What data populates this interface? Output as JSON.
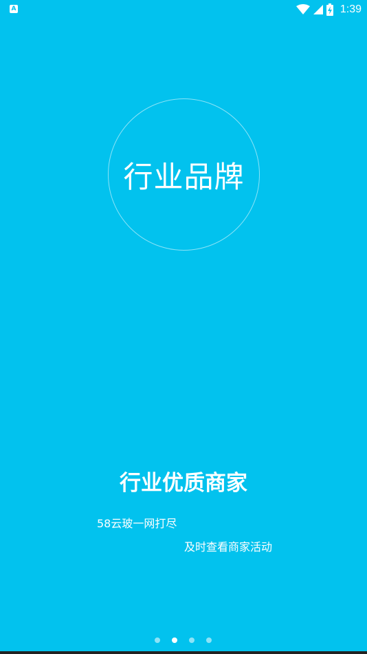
{
  "status_bar": {
    "notification_icon": "A",
    "icons": [
      "wifi-icon",
      "signal-icon",
      "battery-icon"
    ],
    "time": "1:39"
  },
  "splash": {
    "circle_text": "行业品牌",
    "headline": "行业优质商家",
    "line1": "58云玻一网打尽",
    "line2": "及时查看商家活动"
  },
  "pager": {
    "count": 4,
    "active_index": 1
  },
  "colors": {
    "background": "#02c2ee",
    "text": "#ffffff"
  }
}
